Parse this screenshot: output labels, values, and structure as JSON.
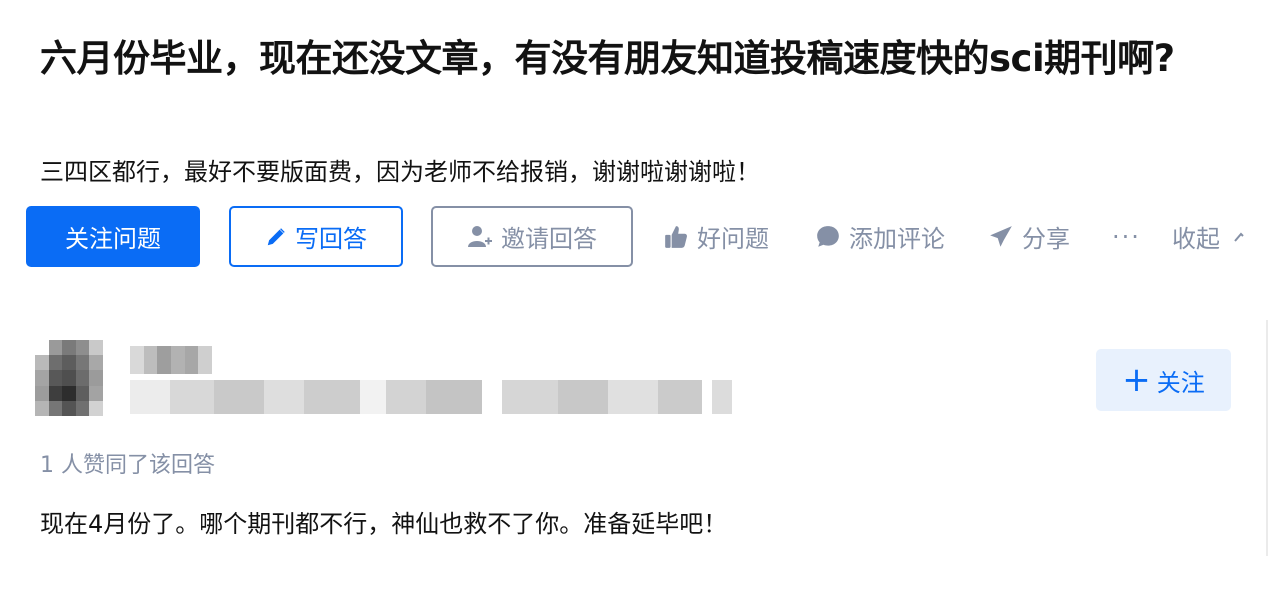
{
  "question": {
    "title": "六月份毕业，现在还没文章，有没有朋友知道投稿速度快的sci期刊啊?",
    "detail": "三四区都行，最好不要版面费，因为老师不给报销，谢谢啦谢谢啦！"
  },
  "actions": {
    "follow_question": "关注问题",
    "write_answer": "写回答",
    "invite_answer": "邀请回答",
    "good_question": "好问题",
    "add_comment": "添加评论",
    "share": "分享",
    "more": "···",
    "collapse": "收起"
  },
  "answer": {
    "follow_author": "关注",
    "vote_count": "1 人赞同了该回答",
    "content": "现在4月份了。哪个期刊都不行，神仙也救不了你。准备延毕吧！"
  },
  "colors": {
    "brand": "#0a6cf5",
    "muted": "#8590a6",
    "follow_author_bg": "#e8f1fd"
  },
  "icons": {
    "write": "pencil-icon",
    "invite": "add-person-icon",
    "good": "thumbs-up-icon",
    "comment": "comment-bubble-icon",
    "share": "paper-plane-icon"
  }
}
